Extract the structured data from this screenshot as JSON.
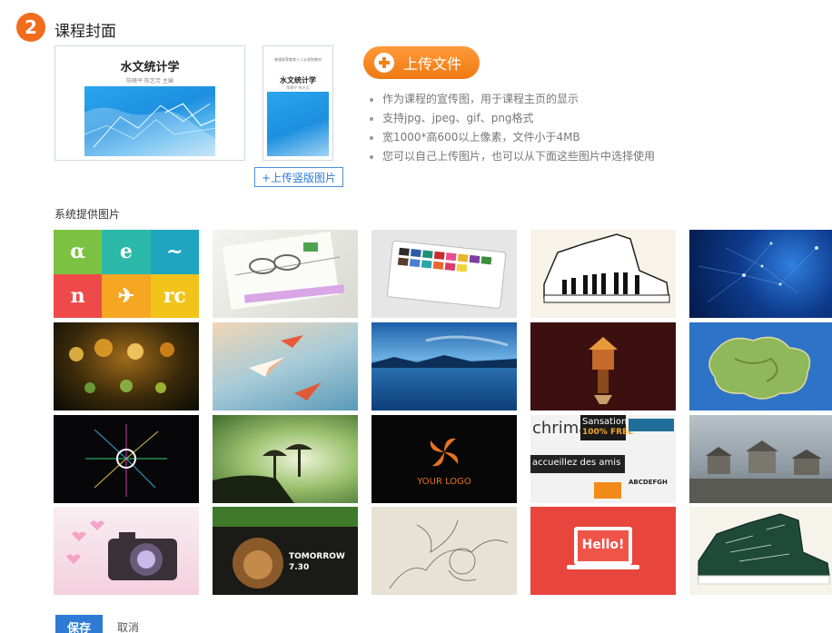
{
  "step": {
    "number": "2",
    "title": "课程封面"
  },
  "cover": {
    "book_title": "水文统计学",
    "book_authors": "陈曦平  陈艺芳  主编",
    "v_series": "普通高等教育十二五规划教材",
    "v_title": "水文统计学",
    "v_authors": "陈曦平  陈艺芳"
  },
  "upload_portrait_label": "+上传竖版图片",
  "upload_button_label": "上传文件",
  "tips": [
    "作为课程的宣传图，用于课程主页的显示",
    "支持jpg、jpeg、gif、png格式",
    "宽1000*高600以上像素，文件小于4MB",
    "您可以自己上传图片，也可以从下面这些图片中选择使用"
  ],
  "gallery_label": "系统提供图片",
  "tile_texts": {
    "your_logo": "YOUR LOGO",
    "hello": "Hello!",
    "sansation": "Sansation",
    "free": "100% FREE",
    "chrimae": "chrimae",
    "accueillez": "accueillez des amis",
    "abcdef": "ABCDEFGH",
    "tomorrow": "TOMORROW",
    "time": "7.30"
  },
  "colors": {
    "accent": "#f36b1c",
    "primary": "#2d7bd4"
  },
  "actions": {
    "save": "保存",
    "cancel": "取消"
  }
}
